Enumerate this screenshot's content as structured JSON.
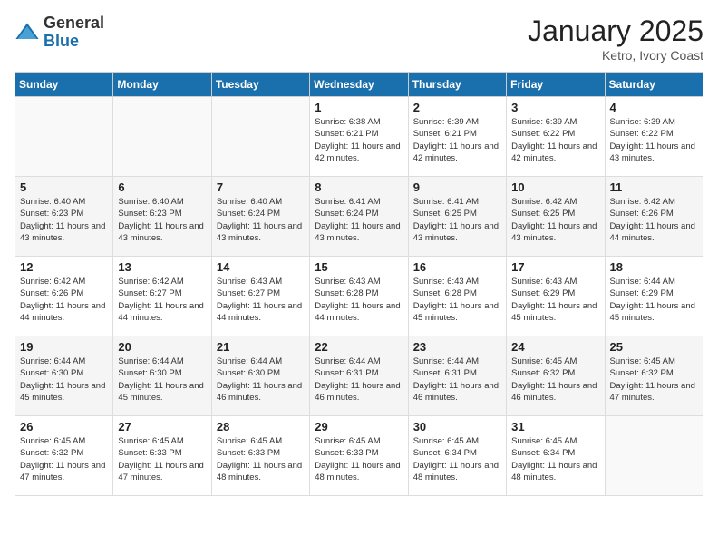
{
  "logo": {
    "general": "General",
    "blue": "Blue"
  },
  "header": {
    "title": "January 2025",
    "location": "Ketro, Ivory Coast"
  },
  "days_of_week": [
    "Sunday",
    "Monday",
    "Tuesday",
    "Wednesday",
    "Thursday",
    "Friday",
    "Saturday"
  ],
  "weeks": [
    [
      {
        "day": "",
        "sunrise": "",
        "sunset": "",
        "daylight": ""
      },
      {
        "day": "",
        "sunrise": "",
        "sunset": "",
        "daylight": ""
      },
      {
        "day": "",
        "sunrise": "",
        "sunset": "",
        "daylight": ""
      },
      {
        "day": "1",
        "sunrise": "Sunrise: 6:38 AM",
        "sunset": "Sunset: 6:21 PM",
        "daylight": "Daylight: 11 hours and 42 minutes."
      },
      {
        "day": "2",
        "sunrise": "Sunrise: 6:39 AM",
        "sunset": "Sunset: 6:21 PM",
        "daylight": "Daylight: 11 hours and 42 minutes."
      },
      {
        "day": "3",
        "sunrise": "Sunrise: 6:39 AM",
        "sunset": "Sunset: 6:22 PM",
        "daylight": "Daylight: 11 hours and 42 minutes."
      },
      {
        "day": "4",
        "sunrise": "Sunrise: 6:39 AM",
        "sunset": "Sunset: 6:22 PM",
        "daylight": "Daylight: 11 hours and 43 minutes."
      }
    ],
    [
      {
        "day": "5",
        "sunrise": "Sunrise: 6:40 AM",
        "sunset": "Sunset: 6:23 PM",
        "daylight": "Daylight: 11 hours and 43 minutes."
      },
      {
        "day": "6",
        "sunrise": "Sunrise: 6:40 AM",
        "sunset": "Sunset: 6:23 PM",
        "daylight": "Daylight: 11 hours and 43 minutes."
      },
      {
        "day": "7",
        "sunrise": "Sunrise: 6:40 AM",
        "sunset": "Sunset: 6:24 PM",
        "daylight": "Daylight: 11 hours and 43 minutes."
      },
      {
        "day": "8",
        "sunrise": "Sunrise: 6:41 AM",
        "sunset": "Sunset: 6:24 PM",
        "daylight": "Daylight: 11 hours and 43 minutes."
      },
      {
        "day": "9",
        "sunrise": "Sunrise: 6:41 AM",
        "sunset": "Sunset: 6:25 PM",
        "daylight": "Daylight: 11 hours and 43 minutes."
      },
      {
        "day": "10",
        "sunrise": "Sunrise: 6:42 AM",
        "sunset": "Sunset: 6:25 PM",
        "daylight": "Daylight: 11 hours and 43 minutes."
      },
      {
        "day": "11",
        "sunrise": "Sunrise: 6:42 AM",
        "sunset": "Sunset: 6:26 PM",
        "daylight": "Daylight: 11 hours and 44 minutes."
      }
    ],
    [
      {
        "day": "12",
        "sunrise": "Sunrise: 6:42 AM",
        "sunset": "Sunset: 6:26 PM",
        "daylight": "Daylight: 11 hours and 44 minutes."
      },
      {
        "day": "13",
        "sunrise": "Sunrise: 6:42 AM",
        "sunset": "Sunset: 6:27 PM",
        "daylight": "Daylight: 11 hours and 44 minutes."
      },
      {
        "day": "14",
        "sunrise": "Sunrise: 6:43 AM",
        "sunset": "Sunset: 6:27 PM",
        "daylight": "Daylight: 11 hours and 44 minutes."
      },
      {
        "day": "15",
        "sunrise": "Sunrise: 6:43 AM",
        "sunset": "Sunset: 6:28 PM",
        "daylight": "Daylight: 11 hours and 44 minutes."
      },
      {
        "day": "16",
        "sunrise": "Sunrise: 6:43 AM",
        "sunset": "Sunset: 6:28 PM",
        "daylight": "Daylight: 11 hours and 45 minutes."
      },
      {
        "day": "17",
        "sunrise": "Sunrise: 6:43 AM",
        "sunset": "Sunset: 6:29 PM",
        "daylight": "Daylight: 11 hours and 45 minutes."
      },
      {
        "day": "18",
        "sunrise": "Sunrise: 6:44 AM",
        "sunset": "Sunset: 6:29 PM",
        "daylight": "Daylight: 11 hours and 45 minutes."
      }
    ],
    [
      {
        "day": "19",
        "sunrise": "Sunrise: 6:44 AM",
        "sunset": "Sunset: 6:30 PM",
        "daylight": "Daylight: 11 hours and 45 minutes."
      },
      {
        "day": "20",
        "sunrise": "Sunrise: 6:44 AM",
        "sunset": "Sunset: 6:30 PM",
        "daylight": "Daylight: 11 hours and 45 minutes."
      },
      {
        "day": "21",
        "sunrise": "Sunrise: 6:44 AM",
        "sunset": "Sunset: 6:30 PM",
        "daylight": "Daylight: 11 hours and 46 minutes."
      },
      {
        "day": "22",
        "sunrise": "Sunrise: 6:44 AM",
        "sunset": "Sunset: 6:31 PM",
        "daylight": "Daylight: 11 hours and 46 minutes."
      },
      {
        "day": "23",
        "sunrise": "Sunrise: 6:44 AM",
        "sunset": "Sunset: 6:31 PM",
        "daylight": "Daylight: 11 hours and 46 minutes."
      },
      {
        "day": "24",
        "sunrise": "Sunrise: 6:45 AM",
        "sunset": "Sunset: 6:32 PM",
        "daylight": "Daylight: 11 hours and 46 minutes."
      },
      {
        "day": "25",
        "sunrise": "Sunrise: 6:45 AM",
        "sunset": "Sunset: 6:32 PM",
        "daylight": "Daylight: 11 hours and 47 minutes."
      }
    ],
    [
      {
        "day": "26",
        "sunrise": "Sunrise: 6:45 AM",
        "sunset": "Sunset: 6:32 PM",
        "daylight": "Daylight: 11 hours and 47 minutes."
      },
      {
        "day": "27",
        "sunrise": "Sunrise: 6:45 AM",
        "sunset": "Sunset: 6:33 PM",
        "daylight": "Daylight: 11 hours and 47 minutes."
      },
      {
        "day": "28",
        "sunrise": "Sunrise: 6:45 AM",
        "sunset": "Sunset: 6:33 PM",
        "daylight": "Daylight: 11 hours and 48 minutes."
      },
      {
        "day": "29",
        "sunrise": "Sunrise: 6:45 AM",
        "sunset": "Sunset: 6:33 PM",
        "daylight": "Daylight: 11 hours and 48 minutes."
      },
      {
        "day": "30",
        "sunrise": "Sunrise: 6:45 AM",
        "sunset": "Sunset: 6:34 PM",
        "daylight": "Daylight: 11 hours and 48 minutes."
      },
      {
        "day": "31",
        "sunrise": "Sunrise: 6:45 AM",
        "sunset": "Sunset: 6:34 PM",
        "daylight": "Daylight: 11 hours and 48 minutes."
      },
      {
        "day": "",
        "sunrise": "",
        "sunset": "",
        "daylight": ""
      }
    ]
  ]
}
